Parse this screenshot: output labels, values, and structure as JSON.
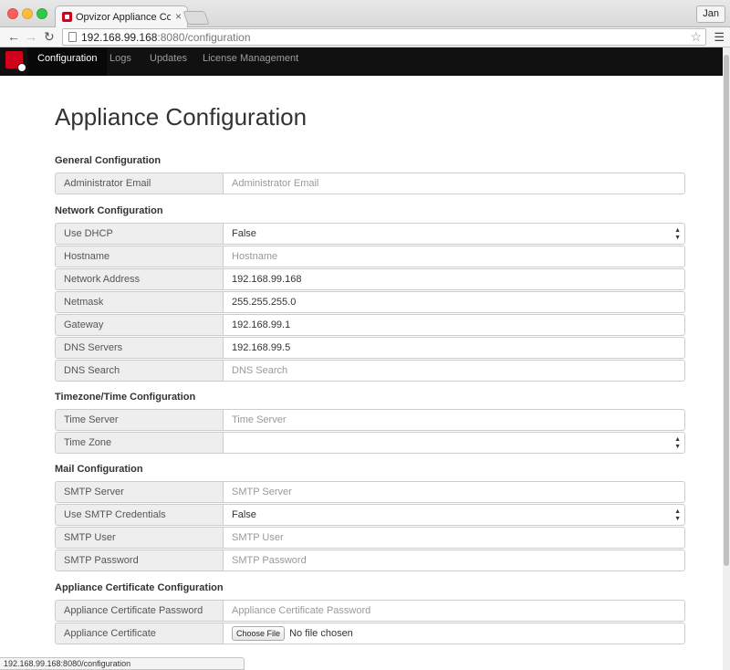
{
  "browser": {
    "tab_title": "Opvizor Appliance Configu",
    "user": "Jan",
    "url_host": "192.168.99.168",
    "url_rest": ":8080/configuration",
    "status_url": "192.168.99.168:8080/configuration"
  },
  "nav": {
    "items": [
      "Configuration",
      "Logs",
      "Updates",
      "License Management"
    ]
  },
  "page": {
    "title": "Appliance Configuration"
  },
  "sections": {
    "general": {
      "title": "General Configuration",
      "admin_email": {
        "label": "Administrator Email",
        "placeholder": "Administrator Email"
      }
    },
    "network": {
      "title": "Network Configuration",
      "use_dhcp": {
        "label": "Use DHCP",
        "value": "False"
      },
      "hostname": {
        "label": "Hostname",
        "placeholder": "Hostname"
      },
      "network_address": {
        "label": "Network Address",
        "value": "192.168.99.168"
      },
      "netmask": {
        "label": "Netmask",
        "value": "255.255.255.0"
      },
      "gateway": {
        "label": "Gateway",
        "value": "192.168.99.1"
      },
      "dns_servers": {
        "label": "DNS Servers",
        "value": "192.168.99.5"
      },
      "dns_search": {
        "label": "DNS Search",
        "placeholder": "DNS Search"
      }
    },
    "time": {
      "title": "Timezone/Time Configuration",
      "time_server": {
        "label": "Time Server",
        "placeholder": "Time Server"
      },
      "time_zone": {
        "label": "Time Zone",
        "value": ""
      }
    },
    "mail": {
      "title": "Mail Configuration",
      "smtp_server": {
        "label": "SMTP Server",
        "placeholder": "SMTP Server"
      },
      "use_smtp_credentials": {
        "label": "Use SMTP Credentials",
        "value": "False"
      },
      "smtp_user": {
        "label": "SMTP User",
        "placeholder": "SMTP User"
      },
      "smtp_password": {
        "label": "SMTP Password",
        "placeholder": "SMTP Password"
      }
    },
    "cert": {
      "title": "Appliance Certificate Configuration",
      "cert_password": {
        "label": "Appliance Certificate Password",
        "placeholder": "Appliance Certificate Password"
      },
      "cert_file": {
        "label": "Appliance Certificate",
        "button": "Choose File",
        "status": "No file chosen"
      }
    }
  }
}
